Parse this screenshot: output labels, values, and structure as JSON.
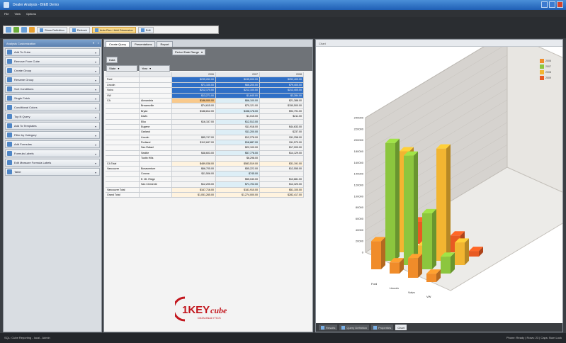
{
  "window": {
    "title": "Dealer Analysis - BIEB Demo"
  },
  "menu": [
    "File",
    "View",
    "Options"
  ],
  "toolbar": {
    "buttons": [
      "Show Definition",
      "Refresh",
      "Auto Run / Add Dimension",
      "Edit"
    ]
  },
  "sidebar": {
    "title": "Analysis Customization",
    "items": [
      {
        "label": "Add To Cube",
        "icon": "cube-icon"
      },
      {
        "label": "Remove From Cube",
        "icon": "cube-remove-icon"
      },
      {
        "label": "Create Group",
        "icon": "group-icon"
      },
      {
        "label": "Rename Group",
        "icon": "rename-icon"
      },
      {
        "label": "Sort Conditions",
        "icon": "sort-icon"
      },
      {
        "label": "Single Fetch",
        "icon": "fetch-icon"
      },
      {
        "label": "Conditional Colors",
        "icon": "palette-icon"
      },
      {
        "label": "Top N Query",
        "icon": "topn-icon"
      },
      {
        "label": "Add To Templates",
        "icon": "template-icon"
      },
      {
        "label": "Filter by Category",
        "icon": "filter-icon"
      },
      {
        "label": "Add Formulas",
        "icon": "formula-icon"
      },
      {
        "label": "Formula Labels",
        "icon": "label-icon"
      },
      {
        "label": "Edit Measure Formula Labels",
        "icon": "edit-formula-icon"
      },
      {
        "label": "Table",
        "icon": "table-icon"
      }
    ]
  },
  "center": {
    "tabs": [
      "Create Query",
      "Presentations",
      "Report"
    ],
    "filters": [
      "Data",
      "Period Date Range",
      "State",
      "Year"
    ],
    "columns": [
      "",
      "",
      "2006",
      "2007",
      "2008"
    ],
    "rows": [
      {
        "a": "Ford",
        "b": "",
        "v": [
          "$235,262.00",
          "$245,000.00",
          "$252,400.00"
        ],
        "style": "blue"
      },
      {
        "a": "Lincoln",
        "b": "",
        "v": [
          "$71,100.00",
          "$66,200.00",
          "$79,400.00"
        ],
        "style": "blue"
      },
      {
        "a": "Volvo",
        "b": "",
        "v": [
          "$212,170.00",
          "$212,100.00",
          "$212,400.00"
        ],
        "style": "blue"
      },
      {
        "a": "VW",
        "b": "",
        "v": [
          "$13,271.00",
          "$1,645.00",
          "$3,284.00"
        ],
        "style": "blue"
      },
      {
        "a": "CA",
        "b": "Alexandria",
        "v": [
          "$188,000.00",
          "$66,100.00",
          "$21,388.00"
        ],
        "style": ""
      },
      {
        "a": "",
        "b": "Brownsville",
        "v": [
          "$74,615.00",
          "$70,121.00",
          "$150,500.00"
        ],
        "style": ""
      },
      {
        "a": "",
        "b": "Bryan",
        "v": [
          "$188,812.00",
          "$438,178.00",
          "$92,791.00"
        ],
        "style": ""
      },
      {
        "a": "",
        "b": "Davis",
        "v": [
          "",
          "$1,015.00",
          "$211.00"
        ],
        "style": ""
      },
      {
        "a": "",
        "b": "Elko",
        "v": [
          "$16,157.00",
          "$12,513.00",
          ""
        ],
        "style": ""
      },
      {
        "a": "",
        "b": "Eugene",
        "v": [
          "",
          "$11,918.00",
          "$44,633.00"
        ],
        "style": ""
      },
      {
        "a": "",
        "b": "Garland",
        "v": [
          "",
          "$11,200.00",
          "$237.00"
        ],
        "style": ""
      },
      {
        "a": "",
        "b": "Lincoln",
        "v": [
          "$85,747.00",
          "$12,278.00",
          "$11,258.00"
        ],
        "style": ""
      },
      {
        "a": "",
        "b": "Portland",
        "v": [
          "$112,847.00",
          "$18,887.00",
          "$11,570.00"
        ],
        "style": ""
      },
      {
        "a": "",
        "b": "San Rafael",
        "v": [
          "",
          "$22,100.00",
          "$17,000.00"
        ],
        "style": ""
      },
      {
        "a": "",
        "b": "Seattle",
        "v": [
          "$48,603.00",
          "$57,776.00",
          "$14,129.00"
        ],
        "style": ""
      },
      {
        "a": "",
        "b": "Tustin Hills",
        "v": [
          "",
          "$6,298.00",
          ""
        ],
        "style": ""
      },
      {
        "a": "CA Total",
        "b": "",
        "v": [
          "$489,038.00",
          "$583,519.00",
          "$31,191.00"
        ],
        "style": "tot"
      },
      {
        "a": "Vancouver",
        "b": "Bonaventure",
        "v": [
          "$66,705.00",
          "$55,222.00",
          "$12,555.00"
        ],
        "style": ""
      },
      {
        "a": "",
        "b": "Corona",
        "v": [
          "$11,506.00",
          "$745.00",
          ""
        ],
        "style": ""
      },
      {
        "a": "",
        "b": "E. Mt. Ridge",
        "v": [
          "",
          "$55,040.00",
          "$13,881.00"
        ],
        "style": ""
      },
      {
        "a": "",
        "b": "San Clemente",
        "v": [
          "$12,205.00",
          "$71,702.00",
          "$12,320.00"
        ],
        "style": ""
      },
      {
        "a": "Vancouver Total",
        "b": "",
        "v": [
          "$167,716.00",
          "$181,910.00",
          "$51,100.00"
        ],
        "style": "tot"
      },
      {
        "a": "Grand Total",
        "b": "",
        "v": [
          "$1,051,265.00",
          "$1,274,000.00",
          "$282,417.00"
        ],
        "style": "tot"
      }
    ],
    "logo": {
      "brand_a": "1KEY",
      "brand_b": "cube",
      "tagline": "DATA ANALYTICS"
    }
  },
  "chart_pane": {
    "title": "Chart",
    "tabs": [
      "Results",
      "Query Definition",
      "Properties",
      "Chart"
    ],
    "colors": {
      "2006": "#f08c2a",
      "2007": "#8cc63e",
      "2008": "#f2b531",
      "2009": "#e85a22"
    }
  },
  "chart_data": {
    "type": "bar",
    "subtype": "3d-clustered",
    "categories": [
      "Ford",
      "Lincoln",
      "Volvo",
      "VW"
    ],
    "series": [
      {
        "name": "2006",
        "values": [
          50000,
          20000,
          35000,
          15000
        ]
      },
      {
        "name": "2007",
        "values": [
          210000,
          195000,
          100000,
          30000
        ]
      },
      {
        "name": "2008",
        "values": [
          180000,
          20000,
          200000,
          40000
        ]
      },
      {
        "name": "2009",
        "values": [
          40000,
          20000,
          30000,
          10000
        ]
      }
    ],
    "yticks": [
      "0",
      "20000",
      "40000",
      "60000",
      "80000",
      "100000",
      "120000",
      "140000",
      "160000",
      "180000",
      "200000",
      "220000",
      "240000"
    ],
    "ylim": [
      0,
      240000
    ],
    "legend": "top-right"
  },
  "status": {
    "left": "SQL: Cube Reporting - local - Admin",
    "right": "Phone: Ready | Rows: 23 | Caps: Num Lock"
  }
}
